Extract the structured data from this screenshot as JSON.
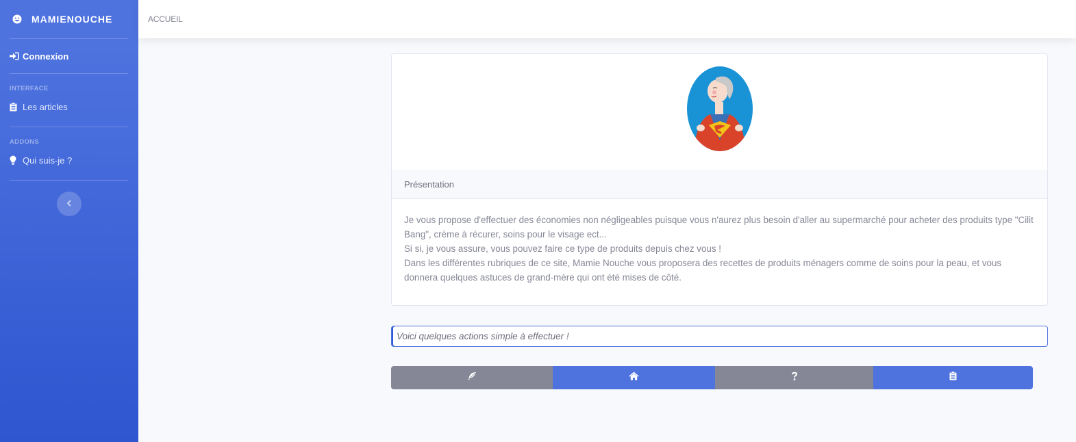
{
  "sidebar": {
    "brand": "MAMIENOUCHE",
    "items": [
      {
        "label": "Connexion",
        "icon": "sign-in-icon"
      },
      {
        "heading": "INTERFACE"
      },
      {
        "label": "Les articles",
        "icon": "clipboard-icon"
      },
      {
        "heading": "ADDONS"
      },
      {
        "label": "Qui suis-je ?",
        "icon": "lightbulb-icon"
      }
    ],
    "toggle_icon": "chevron-left-icon"
  },
  "topbar": {
    "breadcrumb": "ACCUEIL"
  },
  "card": {
    "image": "supergranny-avatar",
    "header": "Présentation",
    "paragraphs": [
      "Je vous propose d'effectuer des économies non négligeables puisque vous n'aurez plus besoin d'aller au supermarché pour acheter des produits type \"Cilit Bang\", crème à récurer, soins pour le visage ect...",
      "Si si, je vous assure, vous pouvez faire ce type de produits depuis chez vous !",
      "Dans les différentes rubriques de ce site, Mamie Nouche vous proposera des recettes de produits ménagers comme de soins pour la peau, et vous donnera quelques astuces de grand-mère qui ont été mises de côté."
    ]
  },
  "action_input": {
    "value": "Voici quelques actions simple à effectuer !"
  },
  "buttons": [
    {
      "icon": "feather-icon",
      "color": "#858796"
    },
    {
      "icon": "home-icon",
      "color": "#4e73df"
    },
    {
      "icon": "question-icon",
      "color": "#858796"
    },
    {
      "icon": "clipboard-icon",
      "color": "#4e73df"
    }
  ],
  "colors": {
    "primary": "#4e73df",
    "secondary": "#858796"
  }
}
